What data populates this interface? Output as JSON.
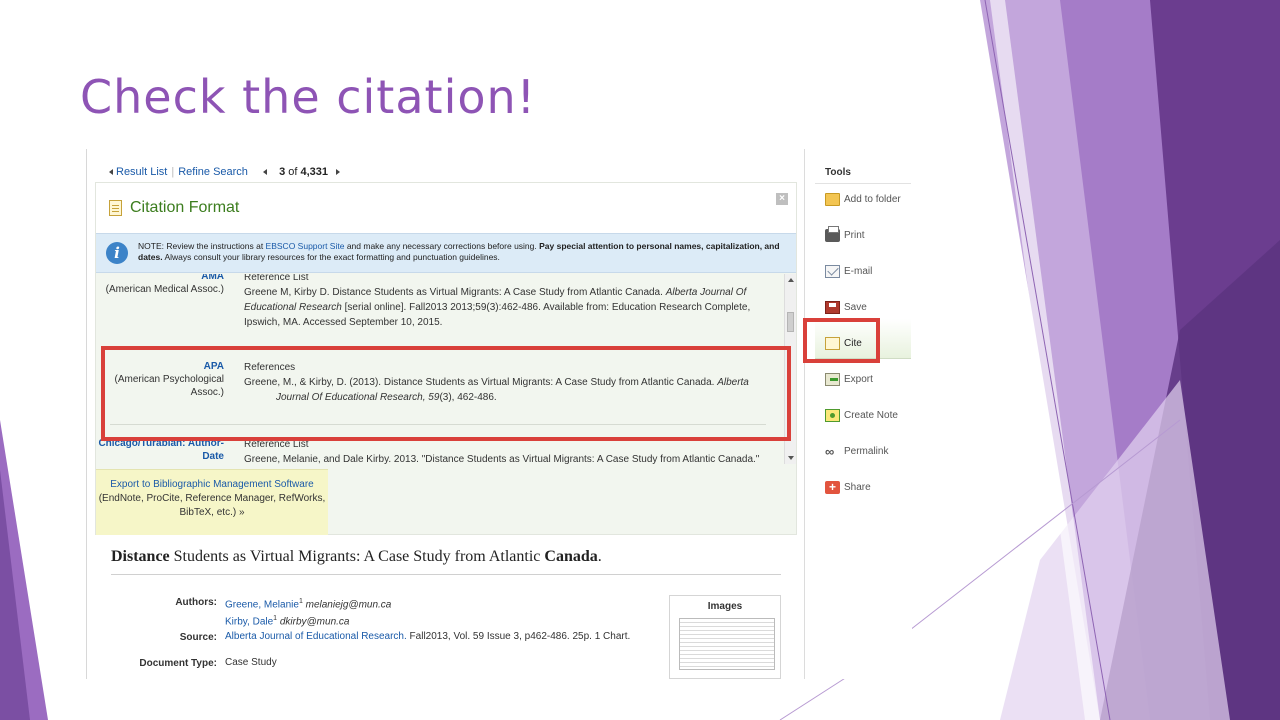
{
  "slide": {
    "title": "Check the citation!",
    "colors": {
      "title": "#8e54b5",
      "highlight_box": "#d9403a"
    }
  },
  "navbar": {
    "result_list": "Result List",
    "refine_search": "Refine Search",
    "pager_current": "3",
    "pager_of": "of",
    "pager_total": "4,331"
  },
  "citation_panel": {
    "title": "Citation Format",
    "close_icon": "close-icon",
    "notice": {
      "prefix": "NOTE: Review the instructions at ",
      "link": "EBSCO Support Site",
      "middle": " and make any necessary corrections before using. ",
      "bold": "Pay special attention to personal names, capitalization, and dates.",
      "suffix": " Always consult your library resources for the exact formatting and punctuation guidelines."
    },
    "styles": [
      {
        "abbr": "AMA",
        "full": "(American Medical Assoc.)",
        "heading": "Reference List",
        "text_a": "Greene M, Kirby D. Distance Students as Virtual Migrants: A Case Study from Atlantic Canada. ",
        "text_italic": "Alberta Journal Of Educational Research",
        "text_b": " [serial online]. Fall2013 2013;59(3):462-486. Available from: Education Research Complete, Ipswich, MA. Accessed September 10, 2015."
      },
      {
        "abbr": "APA",
        "full": "(American Psychological Assoc.)",
        "heading": "References",
        "text_a": "Greene, M., & Kirby, D. (2013). Distance Students as Virtual Migrants: A Case Study from Atlantic Canada. ",
        "text_italic": "Alberta Journal Of Educational Research, 59",
        "text_b": "(3), 462-486."
      },
      {
        "abbr": "Chicago/Turabian: Author-Date",
        "full": "",
        "heading": "Reference List",
        "text_a": "Greene, Melanie, and Dale Kirby. 2013. \"Distance Students as Virtual Migrants: A Case Study from Atlantic Canada.\"",
        "text_italic": "",
        "text_b": ""
      }
    ],
    "export": {
      "link": "Export to Bibliographic Management Software",
      "detail": "(EndNote, ProCite, Reference Manager, RefWorks, BibTeX, etc.) »"
    }
  },
  "article": {
    "title_bold_1": "Distance",
    "title_mid": " Students as Virtual Migrants: A Case Study from Atlantic ",
    "title_bold_2": "Canada",
    "title_end": ".",
    "authors_label": "Authors:",
    "author1_name": "Greene, Melanie",
    "author1_sup": "1",
    "author1_email": "melaniejg@mun.ca",
    "author2_name": "Kirby, Dale",
    "author2_sup": "1",
    "author2_email": "dkirby@mun.ca",
    "source_label": "Source:",
    "source_link": "Alberta Journal of Educational Research.",
    "source_rest": " Fall2013, Vol. 59 Issue 3, p462-486. 25p. 1 Chart.",
    "doctype_label": "Document Type:",
    "doctype_value": "Case Study",
    "images_title": "Images"
  },
  "tools": {
    "title": "Tools",
    "items": [
      {
        "label": "Add to folder",
        "icon": "folder-icon"
      },
      {
        "label": "Print",
        "icon": "printer-icon"
      },
      {
        "label": "E-mail",
        "icon": "email-icon"
      },
      {
        "label": "Save",
        "icon": "save-icon"
      },
      {
        "label": "Cite",
        "icon": "cite-icon"
      },
      {
        "label": "Export",
        "icon": "export-icon"
      },
      {
        "label": "Create Note",
        "icon": "note-icon"
      },
      {
        "label": "Permalink",
        "icon": "link-icon"
      },
      {
        "label": "Share",
        "icon": "share-icon"
      }
    ]
  }
}
